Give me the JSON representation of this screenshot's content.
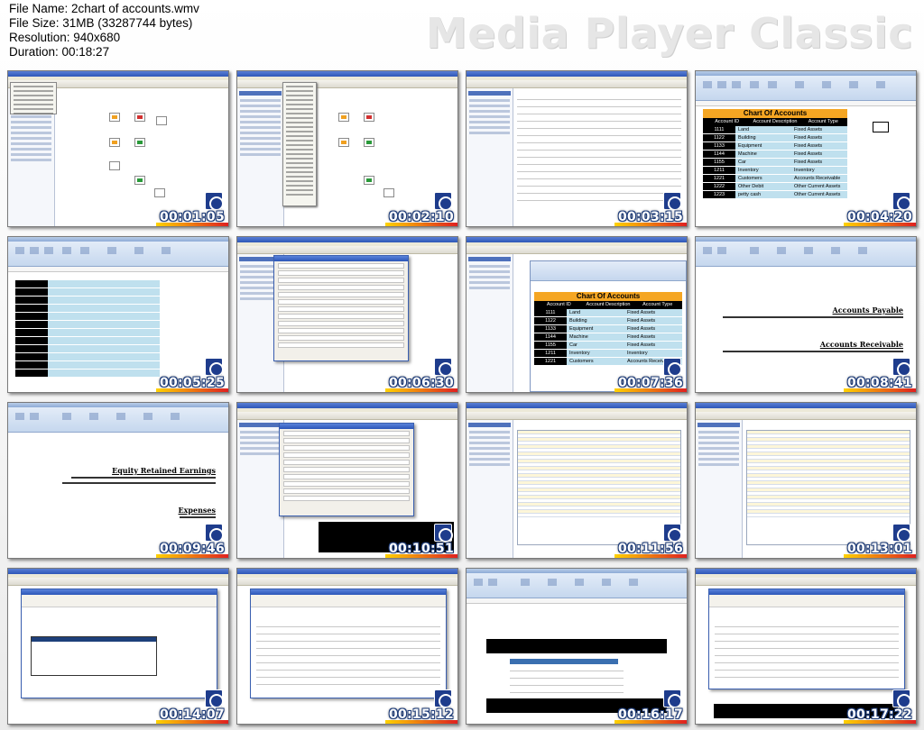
{
  "meta": {
    "file_name": "File Name: 2chart of accounts.wmv",
    "file_size": "File Size: 31MB (33287744 bytes)",
    "resolution": "Resolution: 940x680",
    "duration": "Duration: 00:18:27"
  },
  "brand": "Media Player Classic",
  "sheet": {
    "title": "Chart Of Accounts",
    "headers": [
      "Account ID",
      "Account Description",
      "Account Type"
    ],
    "rows": [
      [
        "1111",
        "Land",
        "Fixed Assets"
      ],
      [
        "1122",
        "Building",
        "Fixed Assets"
      ],
      [
        "1133",
        "Equipment",
        "Fixed Assets"
      ],
      [
        "1144",
        "Machine",
        "Fixed Assets"
      ],
      [
        "1155",
        "Car",
        "Fixed Assets"
      ],
      [
        "1211",
        "Inventory",
        "Inventory"
      ],
      [
        "1221",
        "Customers",
        "Accounts Receivable"
      ],
      [
        "1222",
        "Other Debit",
        "Other Current Assets"
      ],
      [
        "1223",
        "petty cash",
        "Other Current Assets"
      ]
    ]
  },
  "thumbnails": [
    {
      "time": "00:01:05"
    },
    {
      "time": "00:02:10"
    },
    {
      "time": "00:03:15"
    },
    {
      "time": "00:04:20"
    },
    {
      "time": "00:05:25"
    },
    {
      "time": "00:06:30"
    },
    {
      "time": "00:07:36"
    },
    {
      "time": "00:08:41"
    },
    {
      "time": "00:09:46"
    },
    {
      "time": "00:10:51"
    },
    {
      "time": "00:11:56"
    },
    {
      "time": "00:13:01"
    },
    {
      "time": "00:14:07"
    },
    {
      "time": "00:15:12"
    },
    {
      "time": "00:16:17"
    },
    {
      "time": "00:17:22"
    }
  ],
  "doc_text": {
    "accounts_payable": "Accounts Payable",
    "accounts_receivable": "Accounts Receivable",
    "equity_retained": "Equity Retained Earnings",
    "expenses": "Expenses"
  }
}
